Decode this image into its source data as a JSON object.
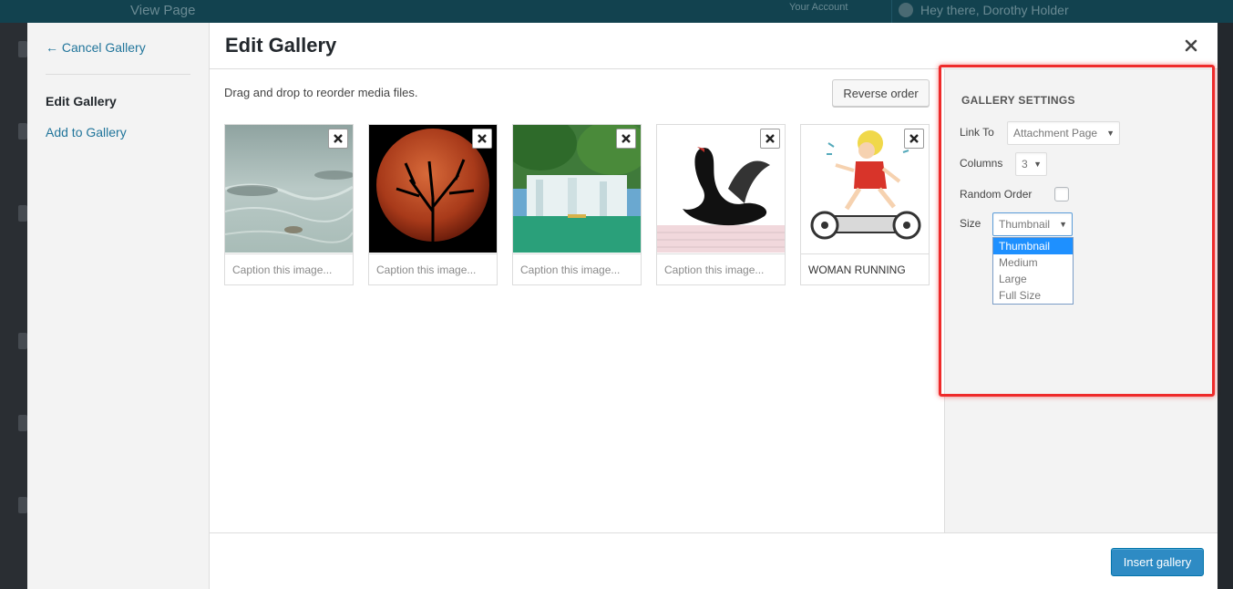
{
  "admin_bar": {
    "view_page": "View Page",
    "your_account": "Your Account",
    "howdy": "Hey there, Dorothy Holder"
  },
  "menu": {
    "cancel_label": "← Cancel Gallery",
    "edit_gallery": "Edit Gallery",
    "add_to_gallery": "Add to Gallery"
  },
  "frame": {
    "title": "Edit Gallery",
    "close_icon": "close-icon"
  },
  "content": {
    "instructions": "Drag and drop to reorder media files.",
    "reverse_order_label": "Reverse order",
    "attachments": [
      {
        "image": "water-surface",
        "caption_value": "",
        "caption_placeholder": "Caption this image..."
      },
      {
        "image": "red-moon-tree",
        "caption_value": "",
        "caption_placeholder": "Caption this image..."
      },
      {
        "image": "waterfall",
        "caption_value": "",
        "caption_placeholder": "Caption this image..."
      },
      {
        "image": "black-swan",
        "caption_value": "",
        "caption_placeholder": "Caption this image..."
      },
      {
        "image": "woman-running-cartoon",
        "caption_value": "WOMAN RUNNING",
        "caption_placeholder": "Caption this image..."
      }
    ]
  },
  "settings": {
    "title": "GALLERY SETTINGS",
    "link_to_label": "Link To",
    "link_to_value": "Attachment Page",
    "columns_label": "Columns",
    "columns_value": "3",
    "random_order_label": "Random Order",
    "random_order_checked": false,
    "size_label": "Size",
    "size_value": "Thumbnail",
    "size_options": [
      "Thumbnail",
      "Medium",
      "Large",
      "Full Size"
    ]
  },
  "toolbar": {
    "insert_label": "Insert gallery"
  },
  "colors": {
    "primary": "#2e8bc4",
    "link": "#21759b",
    "highlight": "#ee2a2a"
  }
}
